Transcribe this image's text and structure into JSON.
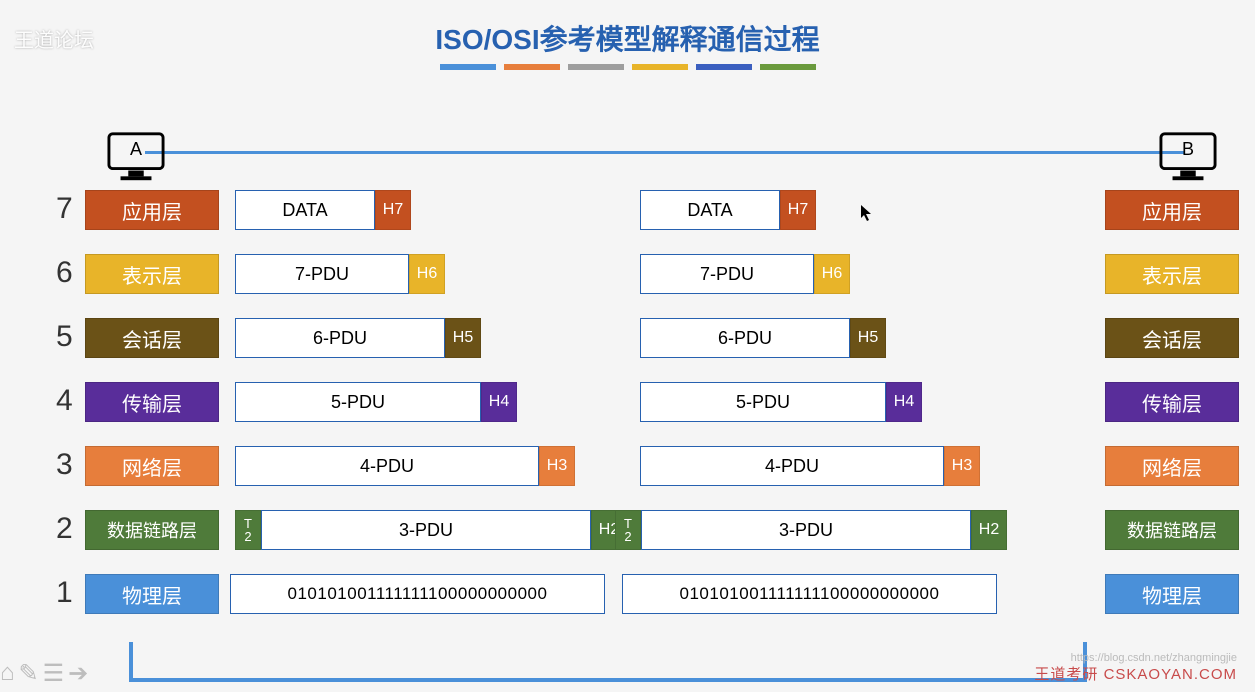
{
  "watermarks": {
    "top_left": "王道论坛",
    "bottom_right_brand": "王道考研 CSKAOYAN.COM",
    "bottom_right_url": "https://blog.csdn.net/zhangmingjie"
  },
  "title": "ISO/OSI参考模型解释通信过程",
  "bar_colors": [
    "#4a90d9",
    "#e77e3c",
    "#9e9e9e",
    "#e8b429",
    "#3b5fbf",
    "#6a9a3d"
  ],
  "hosts": {
    "a": "A",
    "b": "B"
  },
  "layers": [
    {
      "num": "7",
      "name": "应用层",
      "color": "c7",
      "pdu": "DATA",
      "header": "H7",
      "trailer": null,
      "body_width_a": 140,
      "left_a": 225,
      "body_width_b": 140,
      "left_b": 630
    },
    {
      "num": "6",
      "name": "表示层",
      "color": "c6",
      "pdu": "7-PDU",
      "header": "H6",
      "trailer": null,
      "body_width_a": 174,
      "left_a": 225,
      "body_width_b": 174,
      "left_b": 630
    },
    {
      "num": "5",
      "name": "会话层",
      "color": "c5",
      "pdu": "6-PDU",
      "header": "H5",
      "trailer": null,
      "body_width_a": 210,
      "left_a": 225,
      "body_width_b": 210,
      "left_b": 630
    },
    {
      "num": "4",
      "name": "传输层",
      "color": "c4",
      "pdu": "5-PDU",
      "header": "H4",
      "trailer": null,
      "body_width_a": 246,
      "left_a": 225,
      "body_width_b": 246,
      "left_b": 630
    },
    {
      "num": "3",
      "name": "网络层",
      "color": "c3",
      "pdu": "4-PDU",
      "header": "H3",
      "trailer": null,
      "body_width_a": 304,
      "left_a": 225,
      "body_width_b": 304,
      "left_b": 630
    },
    {
      "num": "2",
      "name": "数据链路层",
      "color": "c2",
      "pdu": "3-PDU",
      "header": "H2",
      "trailer": "T2",
      "body_width_a": 330,
      "left_a": 225,
      "body_width_b": 330,
      "left_b": 605
    },
    {
      "num": "1",
      "name": "物理层",
      "color": "c1",
      "pdu": "010101001111111100000000000",
      "header": null,
      "trailer": null,
      "body_width_a": 375,
      "left_a": 220,
      "body_width_b": 375,
      "left_b": 612
    }
  ]
}
